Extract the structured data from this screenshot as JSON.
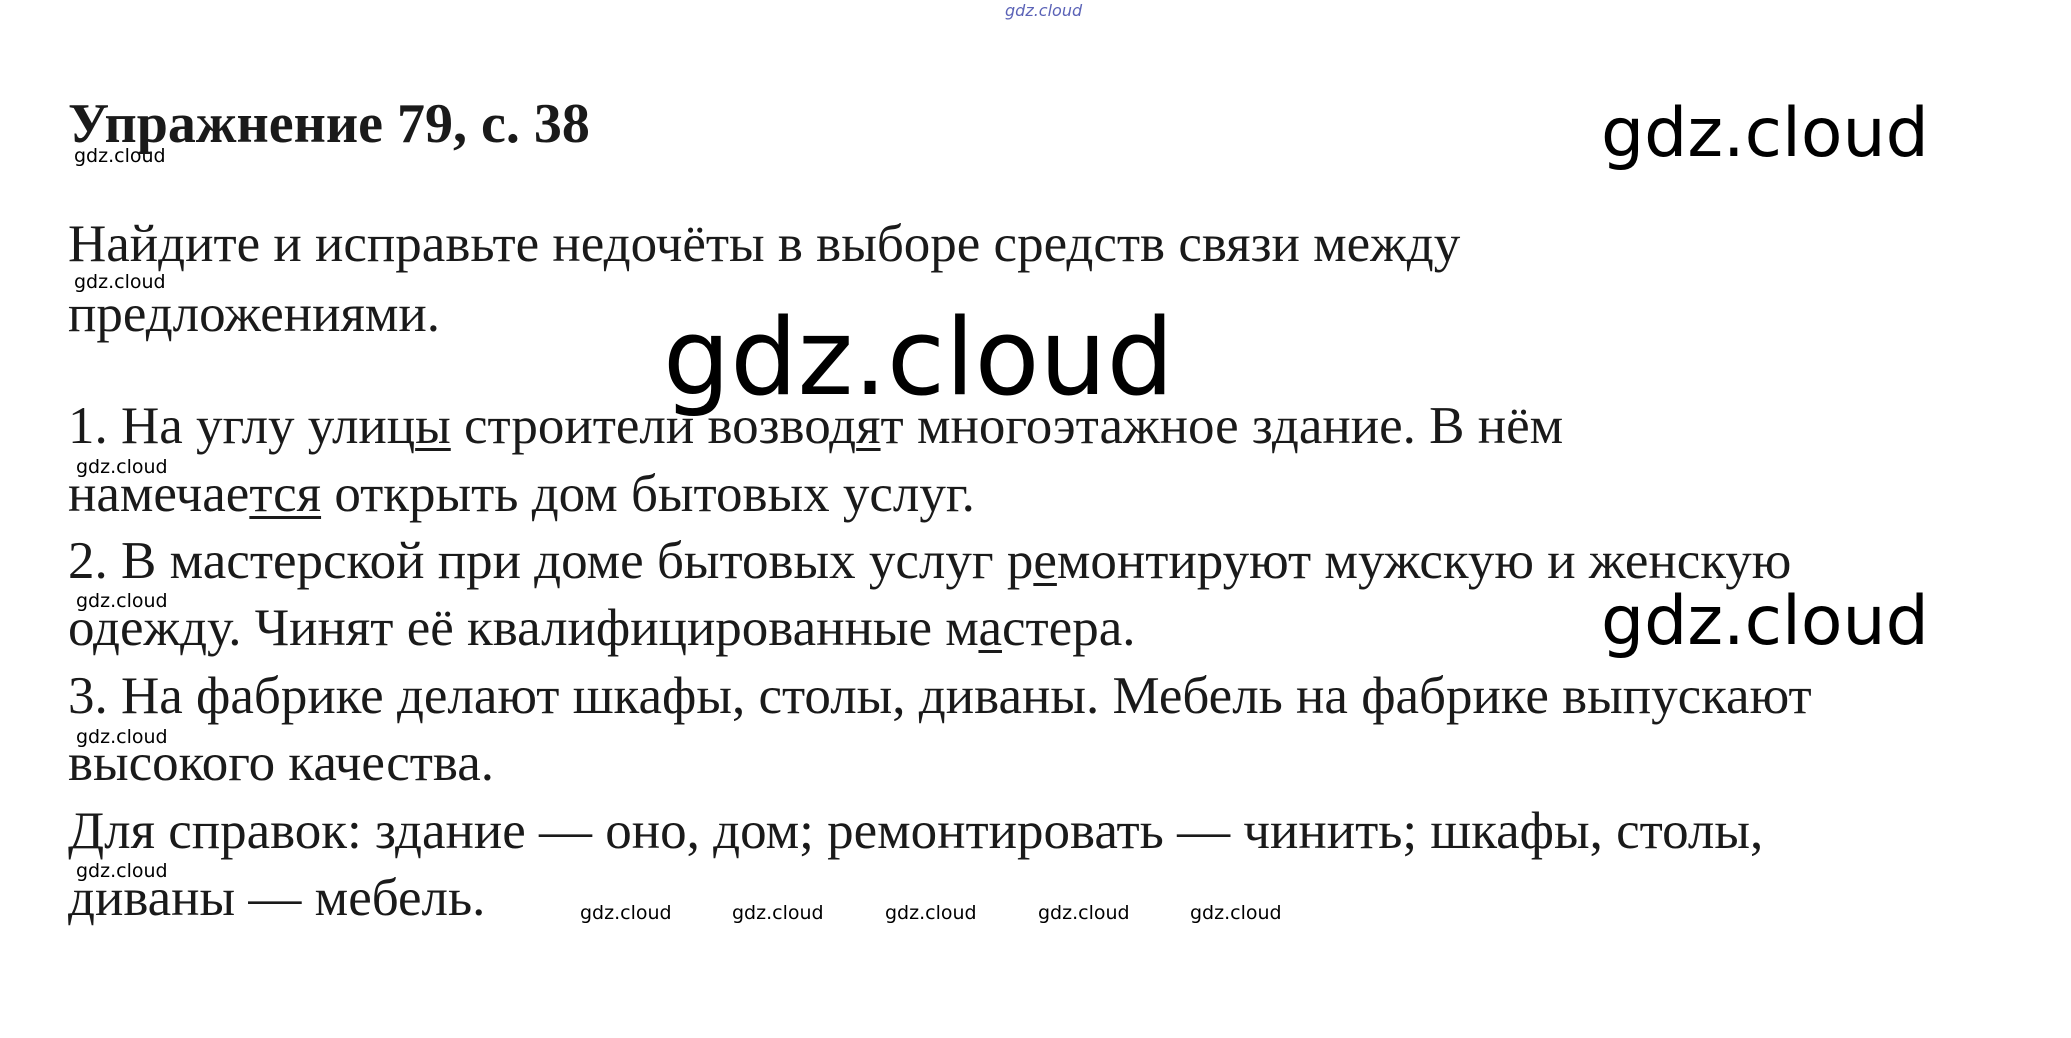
{
  "watermark": {
    "text": "gdz.cloud"
  },
  "title": "Упражнение 79, с. 38",
  "task": {
    "line1": "Найдите и исправьте недочёты в выборе средств связи между",
    "line2": "предложениями."
  },
  "items": {
    "s1": {
      "l1_a": "1. На углу улиц",
      "l1_u1": "ы",
      "l1_b": " строители возвод",
      "l1_u2": "я",
      "l1_c": "т многоэтажное здание. В нём",
      "l2_a": "намечае",
      "l2_u": "тся",
      "l2_b": " открыть дом бытовых услуг."
    },
    "s2": {
      "l1_a": "2. В мастерской при доме бытовых услуг р",
      "l1_u": "е",
      "l1_b": "монтируют мужскую и женскую",
      "l2_a": "одежду. Чинят её квалифицированные м",
      "l2_u": "а",
      "l2_b": "стера."
    },
    "s3": {
      "l1": "3. На фабрике делают шкафы, столы, диваны. Мебель на фабрике выпускают",
      "l2": "высокого качества."
    }
  },
  "reference": {
    "line1": "Для справок: здание — оно, дом; ремонтировать — чинить; шкафы, столы,",
    "line2": "диваны — мебель."
  }
}
